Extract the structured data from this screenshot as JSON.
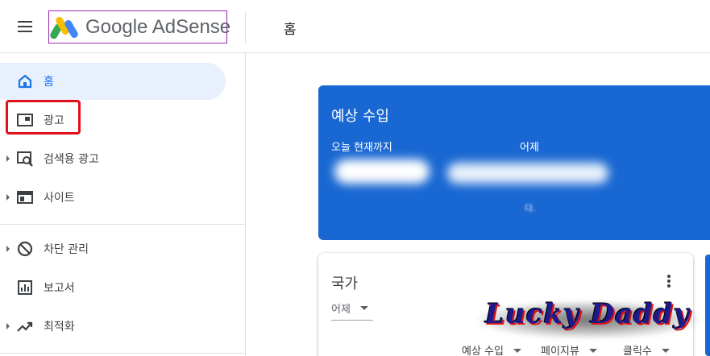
{
  "header": {
    "logo_text": "Google AdSense",
    "page_title": "홈"
  },
  "sidebar": {
    "items": [
      {
        "label": "홈",
        "icon": "home-icon",
        "active": true
      },
      {
        "label": "광고",
        "icon": "ads-icon",
        "active": false
      },
      {
        "label": "검색용 광고",
        "icon": "search-ads-icon",
        "active": false
      },
      {
        "label": "사이트",
        "icon": "sites-icon",
        "active": false
      },
      {
        "label": "차단 관리",
        "icon": "block-icon",
        "active": false
      },
      {
        "label": "보고서",
        "icon": "reports-icon",
        "active": false
      },
      {
        "label": "최적화",
        "icon": "optimization-icon",
        "active": false
      }
    ]
  },
  "earnings": {
    "title": "예상 수입",
    "today_label": "오늘 현재까지",
    "yesterday_label": "어제",
    "blurred_note": "다. "
  },
  "country": {
    "title": "국가",
    "date_value": "어제",
    "columns": [
      "예상 수입",
      "페이지뷰",
      "클릭수"
    ]
  },
  "watermark": {
    "text": "Lucky Daddy"
  },
  "colors": {
    "brand_blue": "#1967d2",
    "active_nav_bg": "#e8f0fe",
    "highlight_red": "#e0101c"
  }
}
